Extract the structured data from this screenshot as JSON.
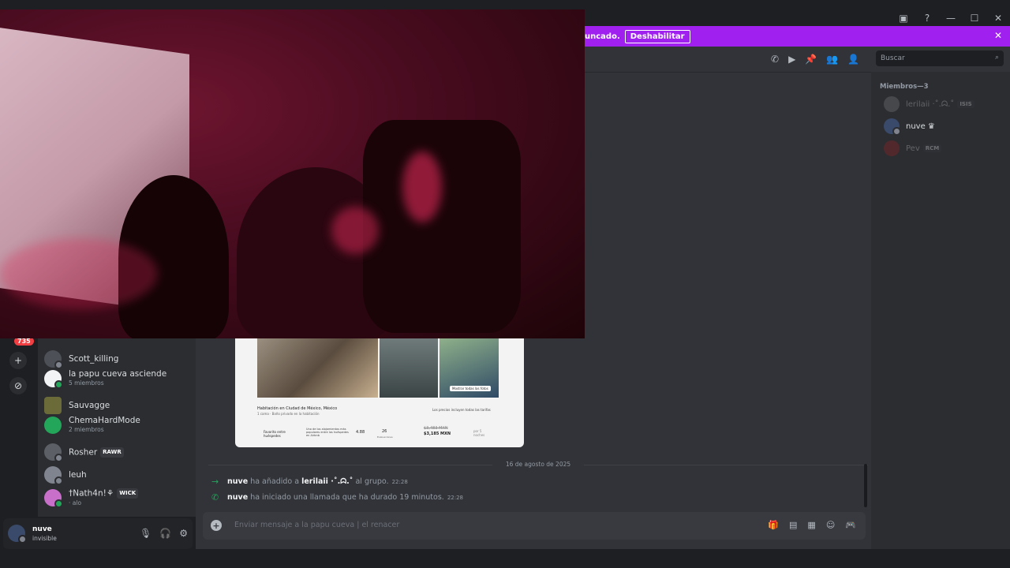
{
  "banner": {
    "text": "uncado.",
    "button": "Deshabilitar"
  },
  "guilds": {
    "unread_badge": "735"
  },
  "dm_list": [
    {
      "name": "Scott_killing",
      "sub": "",
      "tag": "",
      "color": "#4e5058"
    },
    {
      "name": "la papu cueva asciende",
      "sub": "5 miembros",
      "tag": "",
      "color": "#f2f3f5"
    },
    {
      "name": "Sauvagge",
      "sub": "",
      "tag": "",
      "color": "#6b6b3a"
    },
    {
      "name": "ChemaHardMode",
      "sub": "2 miembros",
      "tag": "",
      "color": "#23a55a"
    },
    {
      "name": "Rosher",
      "sub": "",
      "tag": "RAWR",
      "color": "#5c5f66"
    },
    {
      "name": "leuh",
      "sub": "",
      "tag": "",
      "color": "#80848e"
    },
    {
      "name": "†Nath4n!⚘",
      "sub": "· alo",
      "tag": "WICK",
      "color": "#c86fc9"
    }
  ],
  "user_panel": {
    "name": "nuve",
    "status": "invisible"
  },
  "header": {
    "search_placeholder": "Buscar"
  },
  "members": {
    "title": "Miembros—3",
    "list": [
      {
        "name": "lerilaii ·˚.ᗣ.˚",
        "tag": "ISIS",
        "dim": true
      },
      {
        "name": "nuve ♛",
        "tag": "",
        "dim": false
      },
      {
        "name": "Pev",
        "tag": "RCM",
        "dim": true
      }
    ]
  },
  "attachment": {
    "title": "Habitación en Ciudad de México, México",
    "subtitle": "1 cama · Baño privado en la habitación",
    "show_all": "Mostrar todas las fotos",
    "price_old": "$3,483 MXN",
    "price_new": "$3,185 MXN",
    "price_per": "por 5 noches",
    "favorite": "Favorito entre huéspedes",
    "popular": "Uno de los alojamientos más populares entre los huéspedes en Airbnb",
    "rating": "4.88",
    "reviews": "26",
    "reviews_label": "Evaluaciones",
    "low_price": "Los precios incluyen todas las tarifas"
  },
  "chat": {
    "date": "16 de agosto de 2025",
    "messages": [
      {
        "user": "nuve",
        "text_a": " ha añadido a ",
        "target": "lerilaii ·˚.ᗣ.˚",
        "text_b": " al grupo.",
        "time": "22:28"
      },
      {
        "user": "nuve",
        "text_a": " ha iniciado una llamada que ha durado 19 minutos.",
        "time": "22:28"
      }
    ],
    "composer_placeholder": "Enviar mensaje a la papu cueva | el renacer"
  },
  "icons": {
    "titlebar": [
      "screen-share-icon",
      "help-icon",
      "minimize-icon",
      "maximize-icon",
      "close-icon"
    ],
    "header": [
      "call-icon",
      "video-icon",
      "pin-icon",
      "add-member-icon",
      "members-icon"
    ],
    "composer": [
      "gift-icon",
      "gif-icon",
      "sticker-icon",
      "emoji-icon",
      "apps-icon"
    ]
  },
  "colors": {
    "banner": "#a020f0",
    "accent": "#5865f2",
    "online": "#23a55a",
    "badge": "#f23f43"
  }
}
